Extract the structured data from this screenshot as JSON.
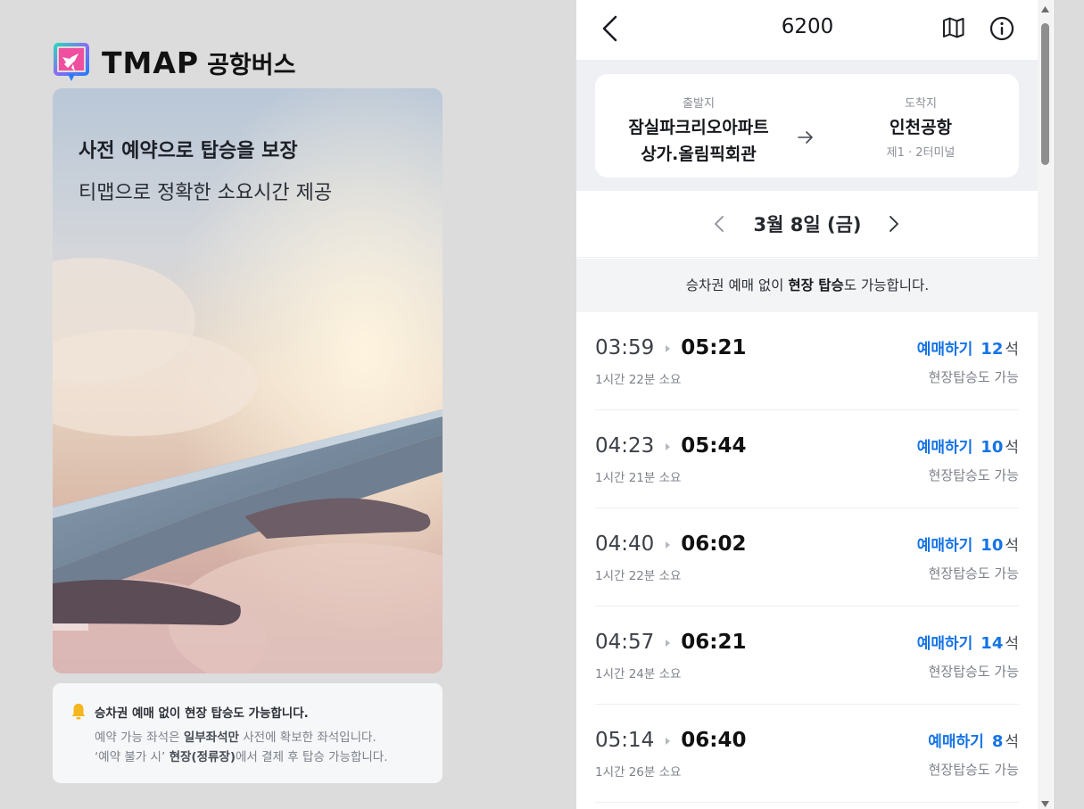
{
  "brand": {
    "name": "TMAP",
    "sub": "공항버스"
  },
  "hero": {
    "title": "사전 예약으로 탑승을 보장",
    "subtitle": "티맵으로 정확한 소요시간 제공"
  },
  "notice": {
    "title": "승차권 예매 없이 현장 탑승도 가능합니다.",
    "line1_pre": "예약 가능 좌석은 ",
    "line1_bold": "일부좌석만",
    "line1_post": " 사전에 확보한 좌석입니다.",
    "line2_pre": "‘예약 불가 시’ ",
    "line2_bold": "현장(정류장)",
    "line2_post": "에서 결제 후 탑승 가능합니다."
  },
  "header": {
    "route_number": "6200"
  },
  "route": {
    "departure_label": "출발지",
    "departure_line1": "잠실파크리오아파트",
    "departure_line2": "상가.올림픽회관",
    "arrival_label": "도착지",
    "arrival_name": "인천공항",
    "arrival_sub": "제1 · 2터미널"
  },
  "date": {
    "text": "3월 8일 (금)"
  },
  "banner": {
    "pre": "승차권 예매 없이 ",
    "bold": "현장 탑승",
    "post": "도 가능합니다."
  },
  "trips": [
    {
      "depart": "03:59",
      "arrive": "05:21",
      "duration": "1시간 22분 소요",
      "book": "예매하기",
      "seats": "12",
      "unit": "석",
      "walkin": "현장탑승도 가능"
    },
    {
      "depart": "04:23",
      "arrive": "05:44",
      "duration": "1시간 21분 소요",
      "book": "예매하기",
      "seats": "10",
      "unit": "석",
      "walkin": "현장탑승도 가능"
    },
    {
      "depart": "04:40",
      "arrive": "06:02",
      "duration": "1시간 22분 소요",
      "book": "예매하기",
      "seats": "10",
      "unit": "석",
      "walkin": "현장탑승도 가능"
    },
    {
      "depart": "04:57",
      "arrive": "06:21",
      "duration": "1시간 24분 소요",
      "book": "예매하기",
      "seats": "14",
      "unit": "석",
      "walkin": "현장탑승도 가능"
    },
    {
      "depart": "05:14",
      "arrive": "06:40",
      "duration": "1시간 26분 소요",
      "book": "예매하기",
      "seats": "8",
      "unit": "석",
      "walkin": "현장탑승도 가능"
    }
  ],
  "colors": {
    "accent": "#1473e6",
    "page_bg": "#dcdcdc",
    "route_bg": "#eef0f3"
  }
}
